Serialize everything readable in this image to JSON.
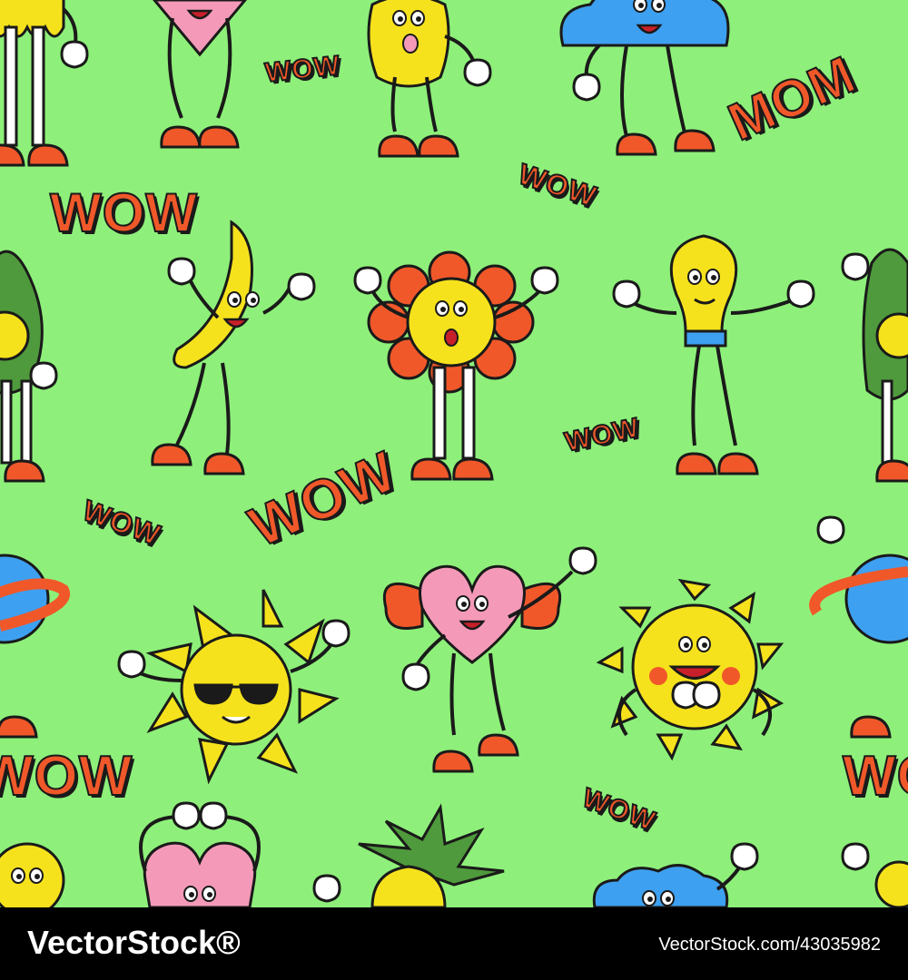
{
  "pattern": {
    "background": "#8ef07a",
    "stickers": [
      "WOW",
      "MOM",
      "WOW",
      "WOW",
      "WOW",
      "WOW",
      "WOW",
      "WOW",
      "WOW"
    ]
  },
  "characters": [
    "sun-drip",
    "heart",
    "durian",
    "cloud",
    "avocado",
    "banana",
    "flower",
    "lightbulb",
    "planet",
    "sun-sunglasses",
    "heart-winged",
    "sun-smiling",
    "heart",
    "pineapple",
    "cloud"
  ],
  "footer": {
    "brand": "VectorStock®",
    "url": "VectorStock.com/43035982"
  }
}
